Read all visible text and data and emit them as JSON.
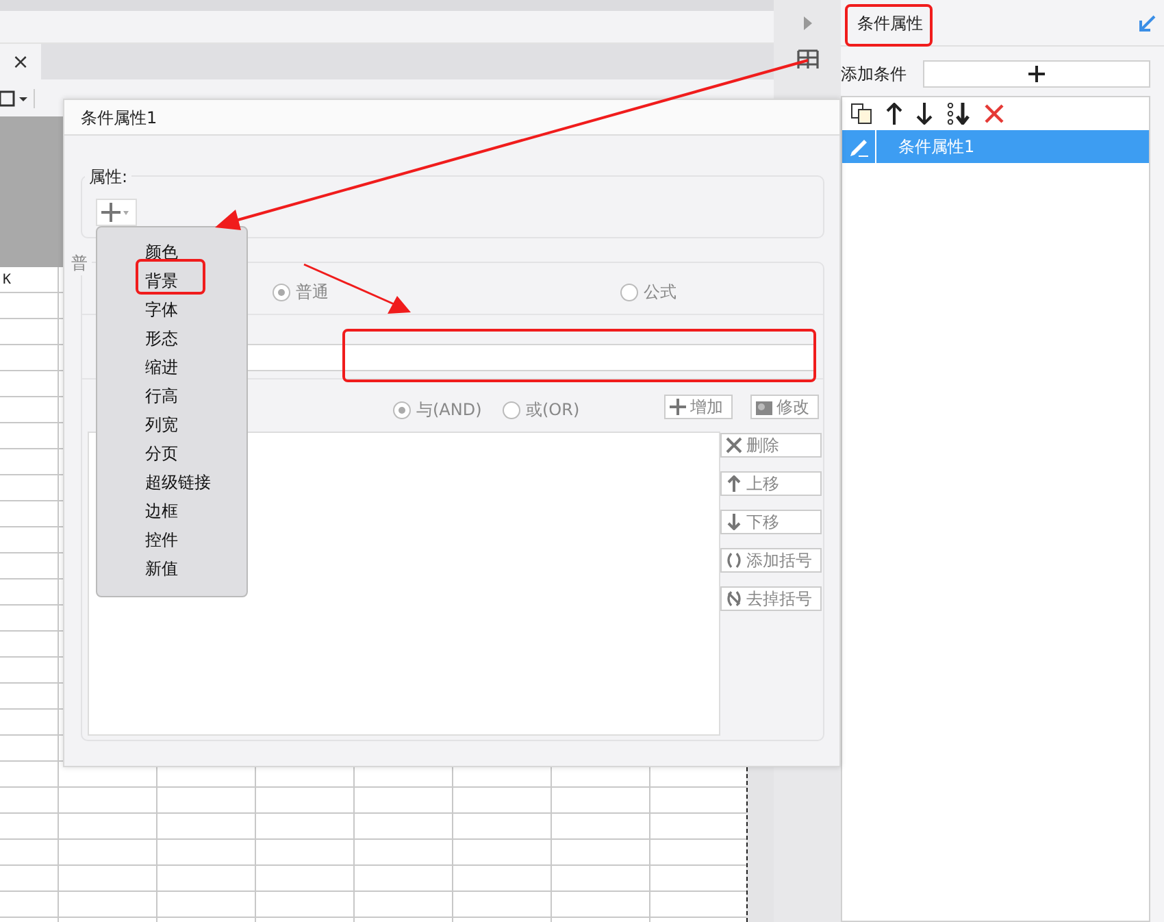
{
  "app": {
    "tab_close": "×",
    "column_header": "K"
  },
  "panel": {
    "tab": "条件属性",
    "add_label": "添加条件",
    "conditions": [
      {
        "label": "条件属性1",
        "selected": true
      }
    ]
  },
  "dialog": {
    "title": "条件属性1",
    "attr_legend": "属性:",
    "section_legend": "普",
    "type_options": [
      {
        "label": "普通",
        "selected": true
      },
      {
        "label": "公式",
        "selected": false
      }
    ],
    "logic_options": [
      {
        "label": "与(AND)",
        "selected": true
      },
      {
        "label": "或(OR)",
        "selected": false
      }
    ],
    "top_buttons": [
      {
        "kind": "add",
        "label": "增加",
        "disabled": true
      },
      {
        "kind": "edit",
        "label": "修改",
        "disabled": true
      }
    ],
    "side_buttons": [
      {
        "kind": "delete",
        "label": "删除",
        "disabled": true
      },
      {
        "kind": "up",
        "label": "上移",
        "disabled": true
      },
      {
        "kind": "down",
        "label": "下移",
        "disabled": true
      },
      {
        "kind": "paren",
        "label": "添加括号",
        "disabled": true
      },
      {
        "kind": "unparen",
        "label": "去掉括号",
        "disabled": true
      }
    ]
  },
  "menu": {
    "items": [
      "颜色",
      "背景",
      "字体",
      "形态",
      "缩进",
      "行高",
      "列宽",
      "分页",
      "超级链接",
      "边框",
      "控件",
      "新值"
    ]
  }
}
